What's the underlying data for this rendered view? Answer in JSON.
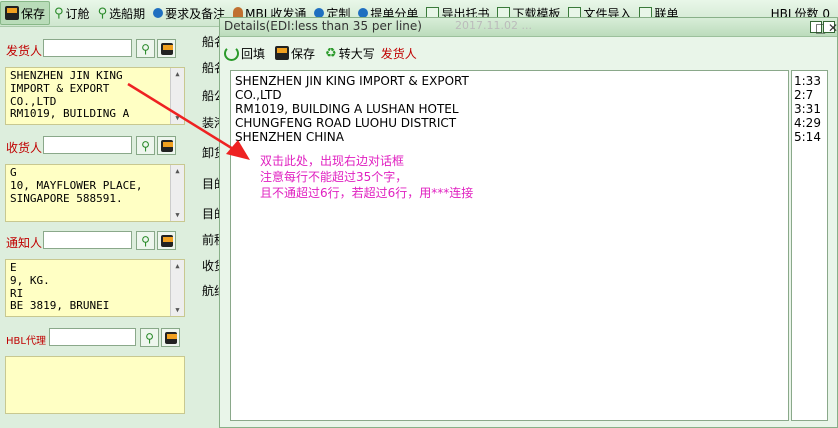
{
  "toolbar": {
    "items": [
      {
        "label": "保存",
        "icon": "save-icon"
      },
      {
        "label": "订舱",
        "icon": "magnifier-icon"
      },
      {
        "label": "选船期",
        "icon": "magnifier-icon"
      },
      {
        "label": "要求及备注",
        "icon": "pin-icon"
      },
      {
        "label": "MBL收发通",
        "icon": "person-icon"
      },
      {
        "label": "定制",
        "icon": "pin-icon"
      },
      {
        "label": "提单分单",
        "icon": "pin-icon"
      },
      {
        "label": "导出托书",
        "icon": "grid-icon"
      },
      {
        "label": "下载模板",
        "icon": "grid-icon"
      },
      {
        "label": "文件导入",
        "icon": "grid-icon"
      },
      {
        "label": "联单",
        "icon": "grid-icon"
      }
    ],
    "hbl_label": "HBL份数 0"
  },
  "left": {
    "shipper_label": "发货人",
    "shipper_lines": [
      "SHENZHEN JIN KING",
      "IMPORT & EXPORT",
      "CO.,LTD",
      "RM1019, BUILDING A"
    ],
    "consignee_label": "收货人",
    "consignee_lines": [
      "",
      "G",
      "10, MAYFLOWER PLACE,",
      "SINGAPORE 588591."
    ],
    "notify_label": "通知人",
    "notify_lines": [
      "E",
      "9, KG.",
      "RI",
      "BE 3819, BRUNEI"
    ],
    "hbl_agent_label": "HBL代理"
  },
  "middle_labels": [
    "船名",
    "船名",
    "船公",
    "装港",
    "卸货",
    "目的",
    "目的",
    "前程",
    "收货",
    "航线"
  ],
  "dialog": {
    "title": "Details(EDI:less than 35 per line)",
    "ghost_text": "2017.11.02   ...",
    "toolbar": {
      "refill": "回填",
      "save": "保存",
      "uppercase": "转大写",
      "shipper": "发货人"
    },
    "lines": [
      "SHENZHEN JIN KING IMPORT & EXPORT",
      "CO.,LTD",
      "RM1019, BUILDING A LUSHAN HOTEL",
      "CHUNGFENG ROAD LUOHU DISTRICT",
      "SHENZHEN CHINA"
    ],
    "line_counts": [
      "1:33",
      "2:7",
      "3:31",
      "4:29",
      "5:14"
    ],
    "hint_lines": [
      "双击此处，出现右边对话框",
      "注意每行不能超过35个字，",
      "且不通超过6行，若超过6行，用***连接"
    ]
  },
  "colors": {
    "background": "#ddeedd",
    "label_red": "#c00000",
    "address_box": "#ffffc4",
    "hint_magenta": "#e020c0",
    "arrow_red": "#ee2222"
  }
}
